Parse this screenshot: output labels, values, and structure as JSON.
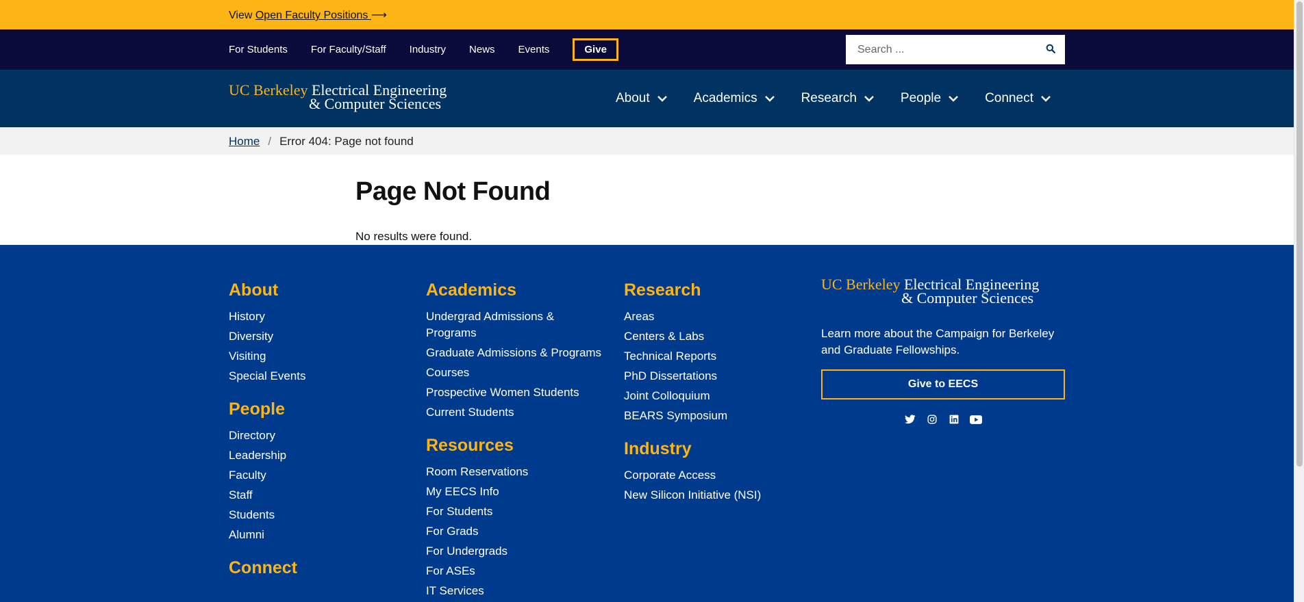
{
  "banner": {
    "prefix": "View",
    "link": "Open Faculty Positions",
    "arrow": "⟶"
  },
  "utility": {
    "links": [
      "For Students",
      "For Faculty/Staff",
      "Industry",
      "News",
      "Events"
    ],
    "give": "Give",
    "search_placeholder": "Search ..."
  },
  "logo": {
    "uc": "UC Berkeley",
    "line1": "Electrical Engineering",
    "line2": "& Computer Sciences"
  },
  "nav": [
    "About",
    "Academics",
    "Research",
    "People",
    "Connect"
  ],
  "breadcrumb": {
    "home": "Home",
    "sep": "/",
    "current": "Error 404: Page not found"
  },
  "content": {
    "title": "Page Not Found",
    "message": "No results were found."
  },
  "footer": {
    "about": {
      "title": "About",
      "items": [
        "History",
        "Diversity",
        "Visiting",
        "Special Events"
      ]
    },
    "people": {
      "title": "People",
      "items": [
        "Directory",
        "Leadership",
        "Faculty",
        "Staff",
        "Students",
        "Alumni"
      ]
    },
    "connect": {
      "title": "Connect"
    },
    "academics": {
      "title": "Academics",
      "items": [
        "Undergrad Admissions & Programs",
        "Graduate Admissions & Programs",
        "Courses",
        "Prospective Women Students",
        "Current Students"
      ]
    },
    "resources": {
      "title": "Resources",
      "items": [
        "Room Reservations",
        "My EECS Info",
        "For Students",
        "For Grads",
        "For Undergrads",
        "For ASEs",
        "IT Services"
      ]
    },
    "research": {
      "title": "Research",
      "items": [
        "Areas",
        "Centers & Labs",
        "Technical Reports",
        "PhD Dissertations",
        "Joint Colloquium",
        "BEARS Symposium"
      ]
    },
    "industry": {
      "title": "Industry",
      "items": [
        "Corporate Access",
        "New Silicon Initiative (NSI)"
      ]
    },
    "campaign_text": "Learn more about the Campaign for Berkeley and Graduate Fellowships.",
    "give_button": "Give to EECS",
    "social_icons": [
      "twitter-icon",
      "instagram-icon",
      "linkedin-icon",
      "youtube-icon"
    ]
  },
  "colors": {
    "gold": "#FDB515",
    "navy": "#003262",
    "footer_blue": "#003a8c",
    "utility_dark": "#0b0b3b"
  }
}
